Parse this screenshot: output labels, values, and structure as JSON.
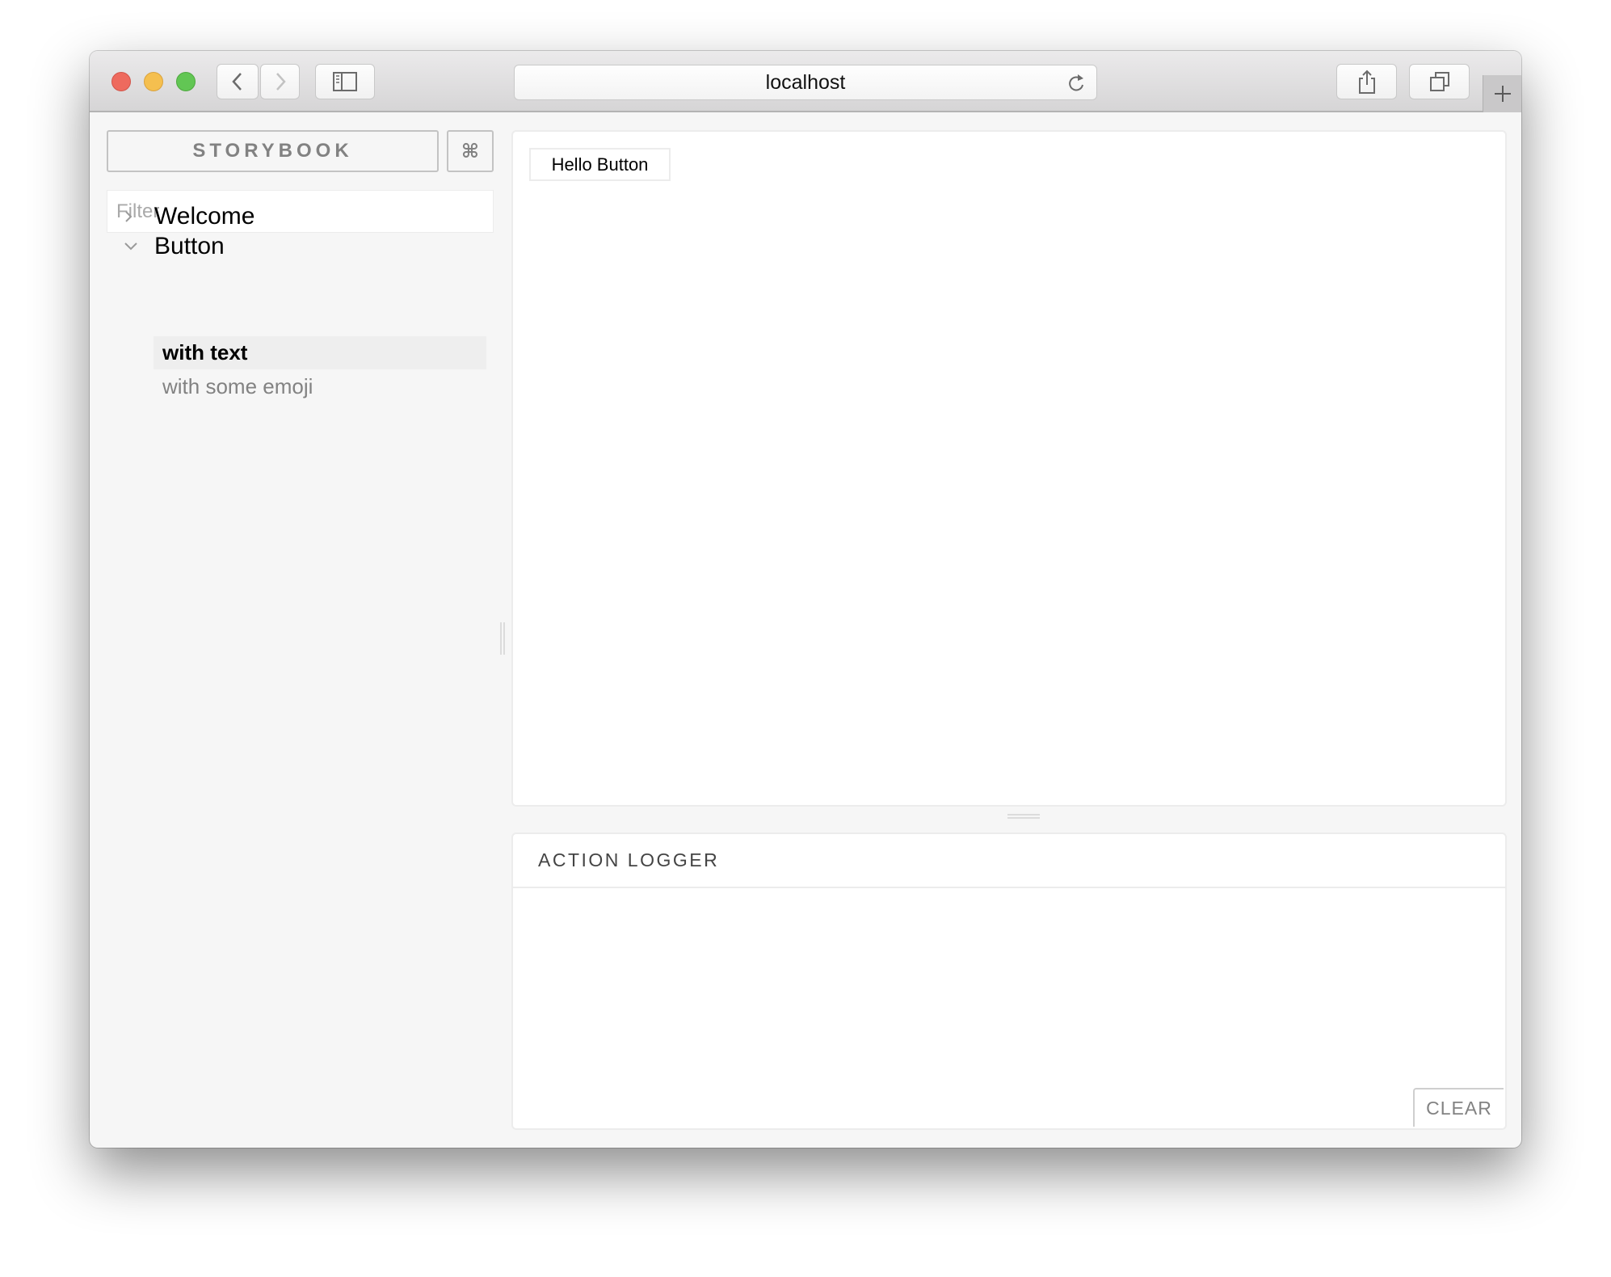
{
  "browser": {
    "address": "localhost",
    "buttons": {
      "close": "close-window",
      "minimize": "minimize-window",
      "zoom": "zoom-window",
      "back": "back",
      "forward": "forward",
      "sidebar": "show-sidebar",
      "reload": "reload",
      "share": "share",
      "tabs": "show-tabs",
      "new_tab": "new-tab"
    }
  },
  "sidebar": {
    "title": "STORYBOOK",
    "shortcut_icon": "⌘",
    "filter": {
      "placeholder": "Filter",
      "value": ""
    },
    "kinds": [
      {
        "label": "Welcome",
        "expanded": false,
        "stories": []
      },
      {
        "label": "Button",
        "expanded": true,
        "stories": [
          {
            "label": "with text",
            "selected": true
          },
          {
            "label": "with some emoji",
            "selected": false
          }
        ]
      }
    ]
  },
  "preview": {
    "button_label": "Hello Button"
  },
  "addon_panel": {
    "title": "ACTION LOGGER",
    "clear_label": "CLEAR",
    "log_entries": []
  }
}
